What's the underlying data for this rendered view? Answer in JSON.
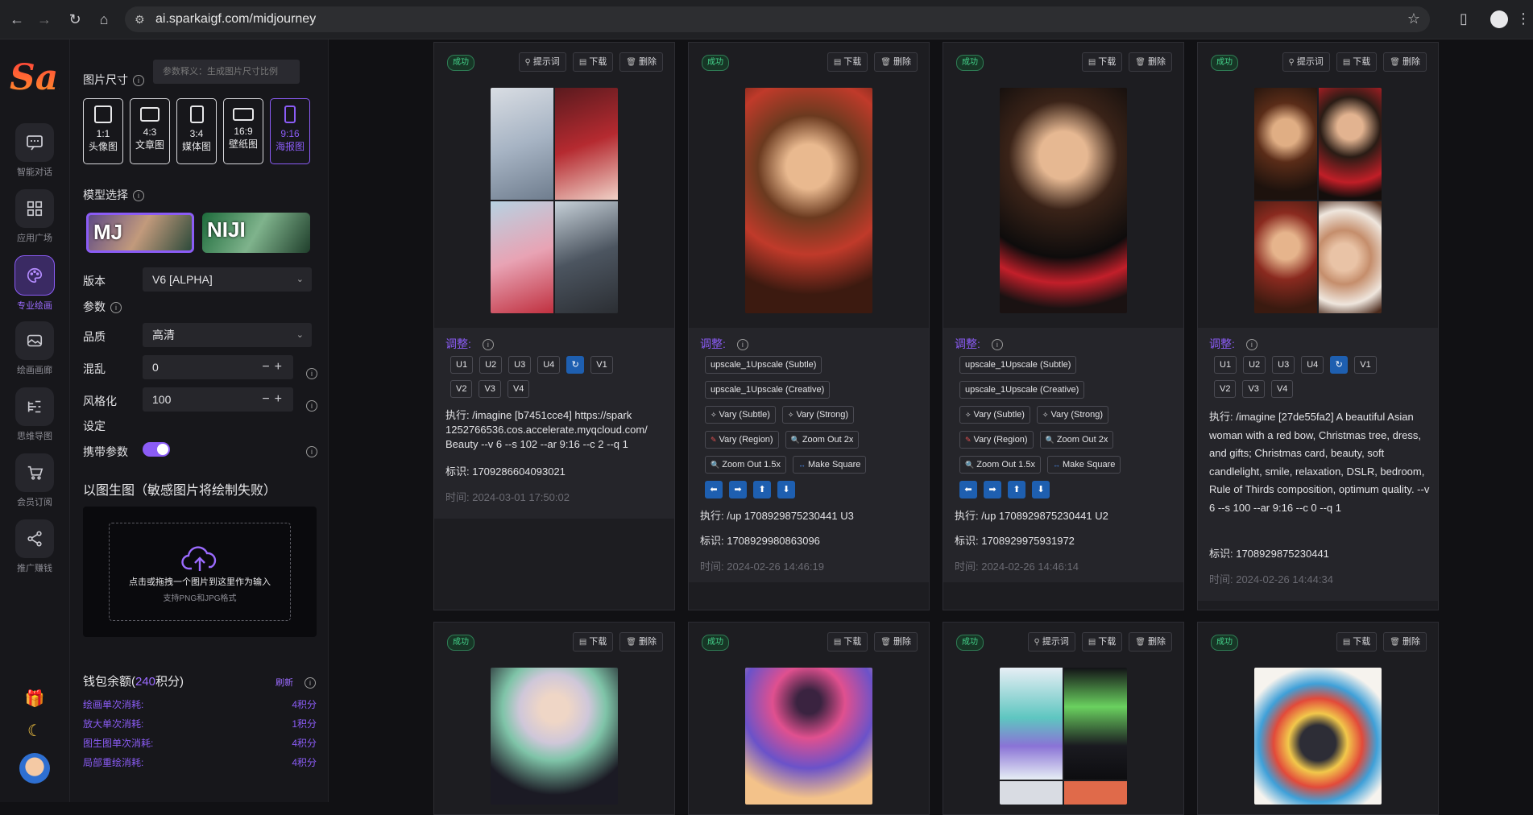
{
  "browser": {
    "url": "ai.sparkaigf.com/midjourney"
  },
  "rail": {
    "logo": "Sai",
    "items": [
      {
        "label": "智能对话",
        "icon": "chat-icon"
      },
      {
        "label": "应用广场",
        "icon": "grid-icon"
      },
      {
        "label": "专业绘画",
        "icon": "palette-icon"
      },
      {
        "label": "绘画画廊",
        "icon": "gallery-icon"
      },
      {
        "label": "思维导图",
        "icon": "mindmap-icon"
      },
      {
        "label": "会员订阅",
        "icon": "cart-icon"
      },
      {
        "label": "推广赚钱",
        "icon": "share-icon"
      }
    ]
  },
  "panel": {
    "size_title": "图片尺寸",
    "size_tooltip": "参数释义：生成图片尺寸比例",
    "ratios": [
      {
        "ratio": "1:1",
        "label": "头像图"
      },
      {
        "ratio": "4:3",
        "label": "文章图"
      },
      {
        "ratio": "3:4",
        "label": "媒体图"
      },
      {
        "ratio": "16:9",
        "label": "壁纸图"
      },
      {
        "ratio": "9:16",
        "label": "海报图"
      }
    ],
    "model_title": "模型选择",
    "models": [
      "MJ",
      "NIJI"
    ],
    "version_label": "版本",
    "version_value": "V6 [ALPHA]",
    "params_label": "参数",
    "quality_label": "品质",
    "quality_value": "高清",
    "chaos_label": "混乱",
    "chaos_value": "0",
    "stylize_label": "风格化",
    "stylize_value": "100",
    "settings_label": "设定",
    "carry_label": "携带参数",
    "img2img_title": "以图生图（敏感图片将绘制失败）",
    "upload_text": "点击或拖拽一个图片到这里作为输入",
    "upload_hint": "支持PNG和JPG格式",
    "wallet_prefix": "钱包余额(",
    "wallet_amount": "240",
    "wallet_suffix": "积分)",
    "refresh": "刷新",
    "costs": [
      {
        "label": "绘画单次消耗:",
        "value": "4积分"
      },
      {
        "label": "放大单次消耗:",
        "value": "1积分"
      },
      {
        "label": "图生图单次消耗:",
        "value": "4积分"
      },
      {
        "label": "局部重绘消耗:",
        "value": "4积分"
      }
    ]
  },
  "common": {
    "status": "成功",
    "prompt_btn": "提示词",
    "download_btn": "下载",
    "delete_btn": "删除",
    "adjust": "调整:"
  },
  "cards": [
    {
      "exec": "执行:   /imagine [b7451cce4] https://spark 1252766536.cos.accelerate.myqcloud.com/ Beauty --v 6 --s 102 --ar 9:16 --c 2 --q 1",
      "id": "标识:    1709286604093021",
      "time": "时间:  2024-03-01 17:50:02"
    },
    {
      "exec": "执行:   /up 1708929875230441 U3",
      "id": "标识:    1708929980863096",
      "time": "时间:  2024-02-26 14:46:19"
    },
    {
      "exec": "执行:   /up 1708929875230441 U2",
      "id": "标识:    1708929975931972",
      "time": "时间:  2024-02-26 14:46:14"
    },
    {
      "exec": "执行:   /imagine [27de55fa2] A beautiful Asian woman with a red bow, Christmas tree, dress, and gifts; Christmas card, beauty, soft candlelight, smile, relaxation, DSLR, bedroom, Rule of Thirds composition, optimum quality. --v 6 --s 100 --ar 9:16 --c 0 --q 1",
      "id": "标识:    1708929875230441",
      "time": "时间:  2024-02-26 14:44:34"
    }
  ],
  "upscale_buttons": [
    "U1",
    "U2",
    "U3",
    "U4",
    "V1",
    "V2",
    "V3",
    "V4"
  ],
  "variation_buttons": {
    "up_subtle": "upscale_1Upscale (Subtle)",
    "up_creative": "upscale_1Upscale (Creative)",
    "vary_subtle": "Vary (Subtle)",
    "vary_strong": "Vary (Strong)",
    "vary_region": "Vary (Region)",
    "zoom2": "Zoom Out 2x",
    "zoom15": "Zoom Out 1.5x",
    "square": "Make Square"
  }
}
